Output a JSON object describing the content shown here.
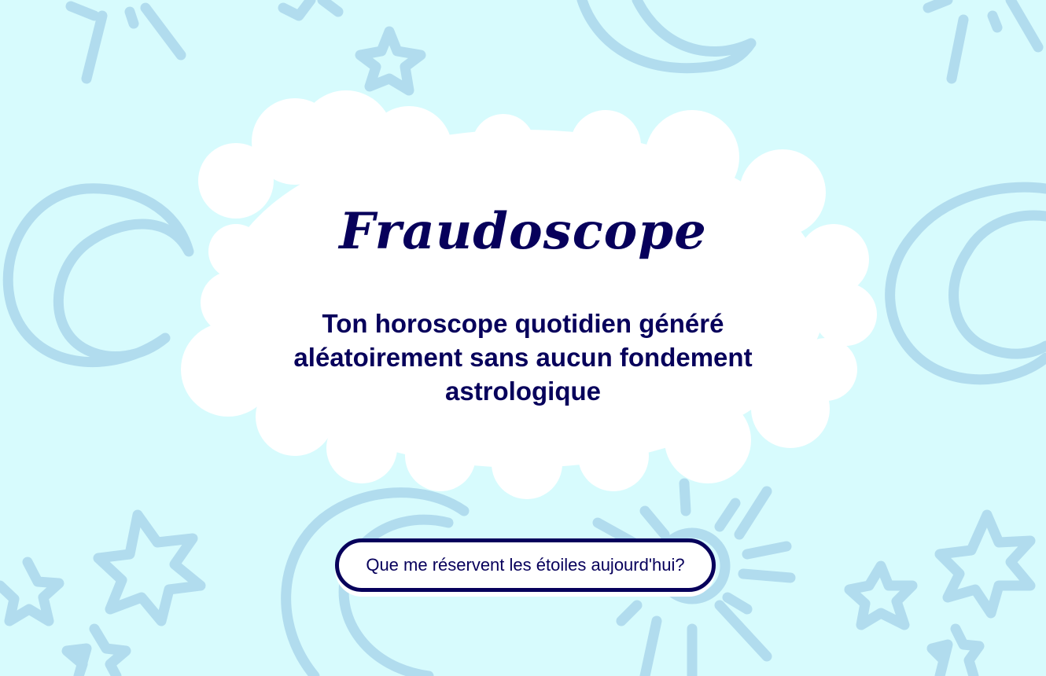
{
  "app": {
    "title": "Fraudoscope",
    "tagline": "Ton horoscope quotidien généré aléatoirement sans aucun fondement astrologique"
  },
  "actions": {
    "cta_label": "Que me réservent les étoiles aujourd'hui?"
  },
  "theme": {
    "background": "#d7fbfd",
    "doodle_color": "#b1dcee",
    "cloud_color": "#ffffff",
    "ink_color": "#07005b"
  },
  "background_icons": [
    "sun-icon",
    "moon-icon",
    "star-icon"
  ]
}
